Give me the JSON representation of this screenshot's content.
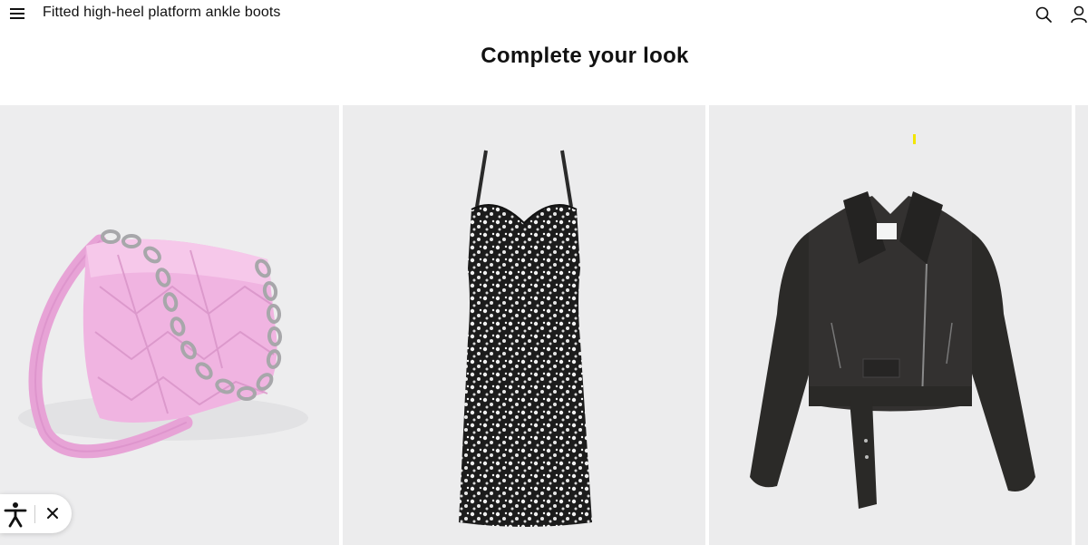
{
  "header": {
    "product_title": "Fitted high-heel platform ankle boots",
    "menu_icon": "hamburger-menu-icon",
    "search_icon": "search-icon",
    "account_icon": "user-account-icon"
  },
  "section": {
    "title": "Complete your look"
  },
  "products": [
    {
      "image": "pink-quilted-shoulder-bag-with-chain"
    },
    {
      "image": "floral-print-strappy-midi-dress"
    },
    {
      "image": "black-faux-leather-biker-jacket"
    }
  ],
  "accessibility_widget": {
    "icon": "accessibility-person-icon",
    "close_icon": "close-icon"
  }
}
